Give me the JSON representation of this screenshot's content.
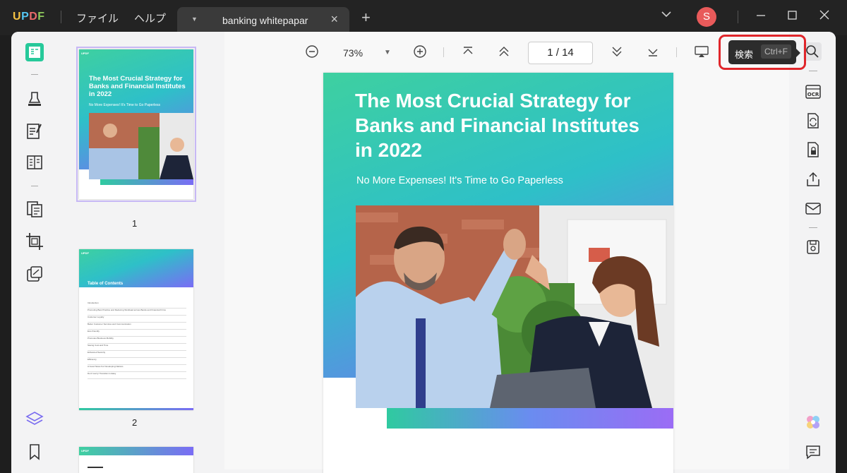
{
  "titlebar": {
    "logo": "UPDF",
    "menu_file": "ファイル",
    "menu_help": "ヘルプ",
    "tab_name": "banking whitepapar",
    "avatar_letter": "S"
  },
  "toolbar": {
    "zoom": "73%",
    "page_current": "1",
    "page_sep": "/",
    "page_total": "14"
  },
  "tooltip": {
    "label": "検索",
    "shortcut": "Ctrl+F"
  },
  "thumbnails": {
    "p1_label": "1",
    "p2_label": "2",
    "p1_title": "The Most Crucial Strategy for Banks and Financial Institutes in 2022",
    "p1_sub": "No More Expenses! It's Time to Go Paperless",
    "p2_title": "Table of Contents",
    "toc_lines": [
      "Introduction",
      "Promoting Best Practice and Reducing Workload across Banks and Financial Firms",
      "Customer Loyalty",
      "Better Customer Services and Communication",
      "Eco-Friendly",
      "Promotes Business Mobility",
      "Saving Cost and Time",
      "Enhanced Security",
      "Efficiency",
      "A Good News For Developing Nations",
      "Don't worry! Transition is Easy"
    ],
    "mini_logo": "UPDF"
  },
  "document": {
    "title": "The Most Crucial Strategy for Banks and Financial Institutes in 2022",
    "subtitle": "No More Expenses! It's Time to Go Paperless"
  },
  "colors": {
    "accent": "#7a6cf0",
    "highlight": "#e0262b",
    "avatar": "#e85a5a"
  }
}
